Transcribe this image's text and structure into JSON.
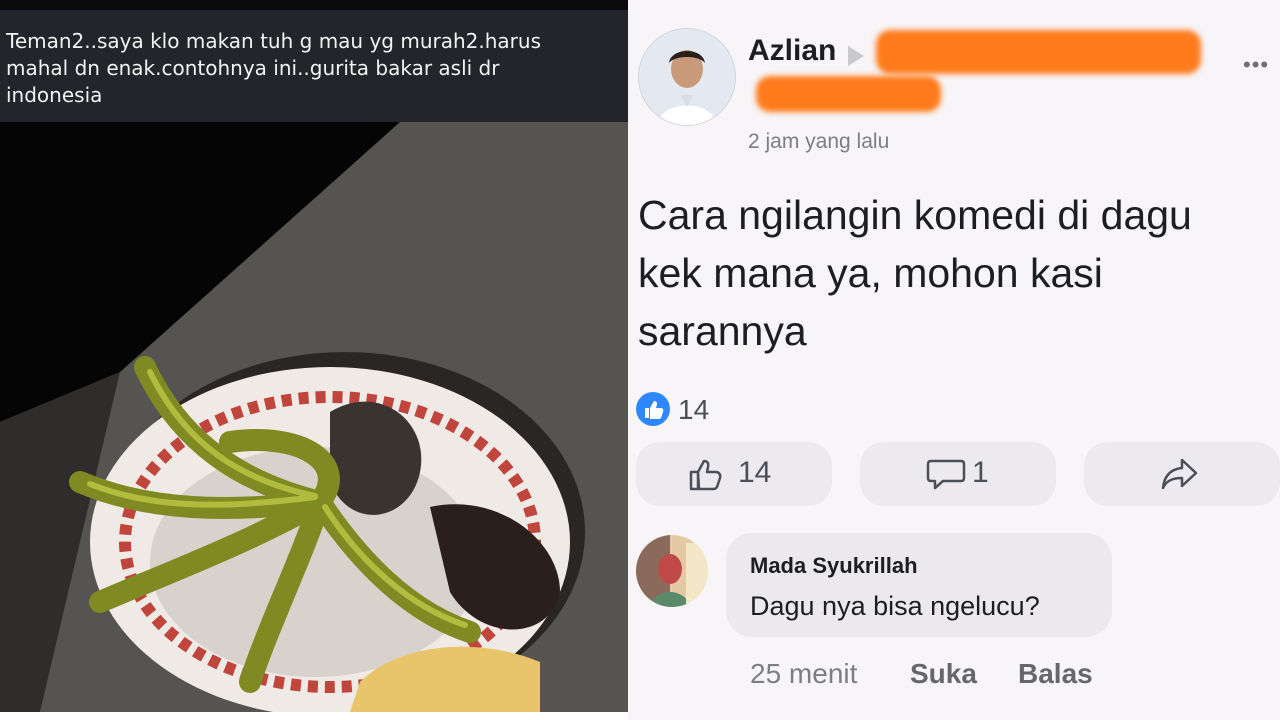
{
  "left_post": {
    "caption": "Teman2..saya klo makan tuh g mau yg murah2.harus\nmahal dn enak.contohnya ini..gurita bakar asli dr\nindonesia"
  },
  "right_post": {
    "author": "Azlian",
    "timestamp": "2 jam yang lalu",
    "text": "Cara ngilangin komedi di dagu kek mana ya, mohon kasi sarannya",
    "reaction_count": "14",
    "like_count": "14",
    "comment_count": "1",
    "comment": {
      "author": "Mada Syukrillah",
      "text": "Dagu nya bisa ngelucu?",
      "age": "25 menit",
      "like_label": "Suka",
      "reply_label": "Balas"
    }
  },
  "icons": {
    "like": "thumbs-up-icon",
    "comment": "speech-bubble-icon",
    "share": "share-arrow-icon",
    "more": "more-dots-icon"
  },
  "colors": {
    "like_blue": "#2d88ff",
    "redaction_orange": "#ff7a1a",
    "caption_bar": "#23252b"
  }
}
